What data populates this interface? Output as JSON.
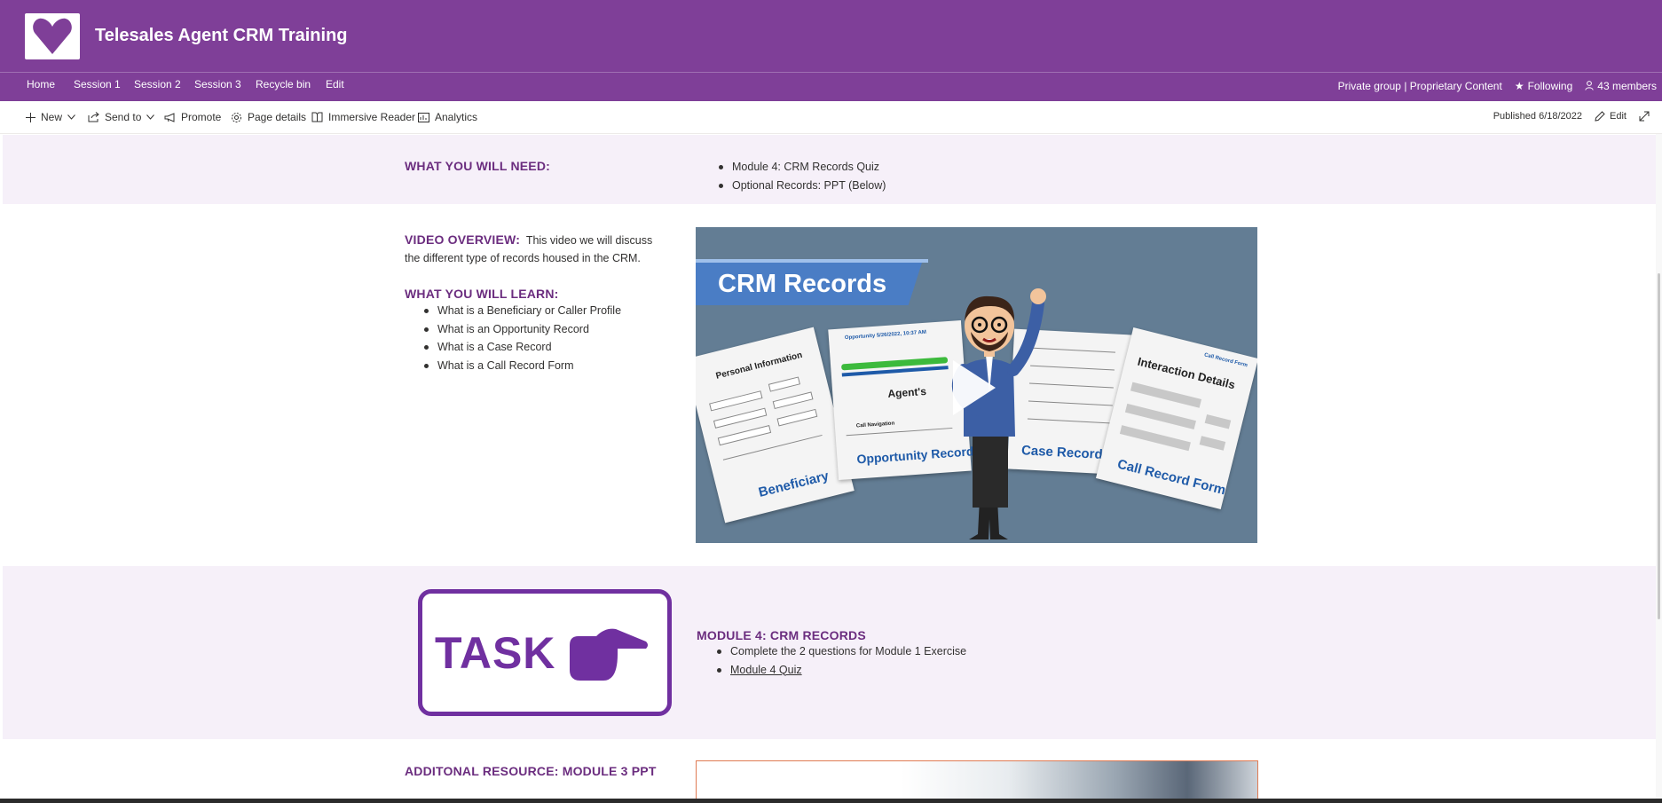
{
  "site": {
    "title": "Telesales Agent CRM Training",
    "nav": [
      "Home",
      "Session 1",
      "Session 2",
      "Session 3",
      "Recycle bin",
      "Edit"
    ],
    "privacy": "Private group | Proprietary Content",
    "following": "Following",
    "members": "43 members"
  },
  "commandbar": {
    "new": "New",
    "send_to": "Send to",
    "promote": "Promote",
    "page_details": "Page details",
    "immersive_reader": "Immersive Reader",
    "analytics": "Analytics",
    "published": "Published 6/18/2022",
    "edit": "Edit"
  },
  "need": {
    "heading": "WHAT YOU WILL NEED:",
    "items": [
      "Module 4: CRM Records Quiz",
      "Optional Records: PPT (Below)"
    ]
  },
  "video_section": {
    "overview_heading": "VIDEO OVERVIEW:",
    "overview_text_1": "This video we will discuss",
    "overview_text_2": "the different type of records housed in the CRM.",
    "learn_heading": "WHAT YOU WILL LEARN:",
    "learn_items": [
      "What is a Beneficiary or Caller Profile",
      "What is an Opportunity Record",
      "What is a Case Record",
      "What is a Call Record Form"
    ]
  },
  "video": {
    "title": "CRM Records",
    "card_labels": [
      "Beneficiary",
      "Opportunity Record",
      "Case Record",
      "Call Record Form"
    ],
    "card_heads": [
      "Personal Information",
      "Agent's",
      "Interaction Details"
    ],
    "opportunity_header": "Opportunity 5/26/2022, 10:37 AM",
    "call_navigation": "Call Navigation",
    "call_record_form_small": "Call Record Form",
    "accent_color": "#4a7dc5",
    "background_color": "#637d94"
  },
  "task": {
    "image_word": "TASK",
    "heading": "MODULE 4: CRM RECORDS",
    "items": [
      "Complete the 2 questions for Module 1 Exercise"
    ],
    "quiz_link": "Module 4 Quiz",
    "color": "#7030a0"
  },
  "resource": {
    "heading": "ADDITONAL RESOURCE: MODULE 3 PPT"
  },
  "theme": {
    "brand": "#7f3f98",
    "heading": "#6b2d7f",
    "band": "#f6f0f9"
  }
}
